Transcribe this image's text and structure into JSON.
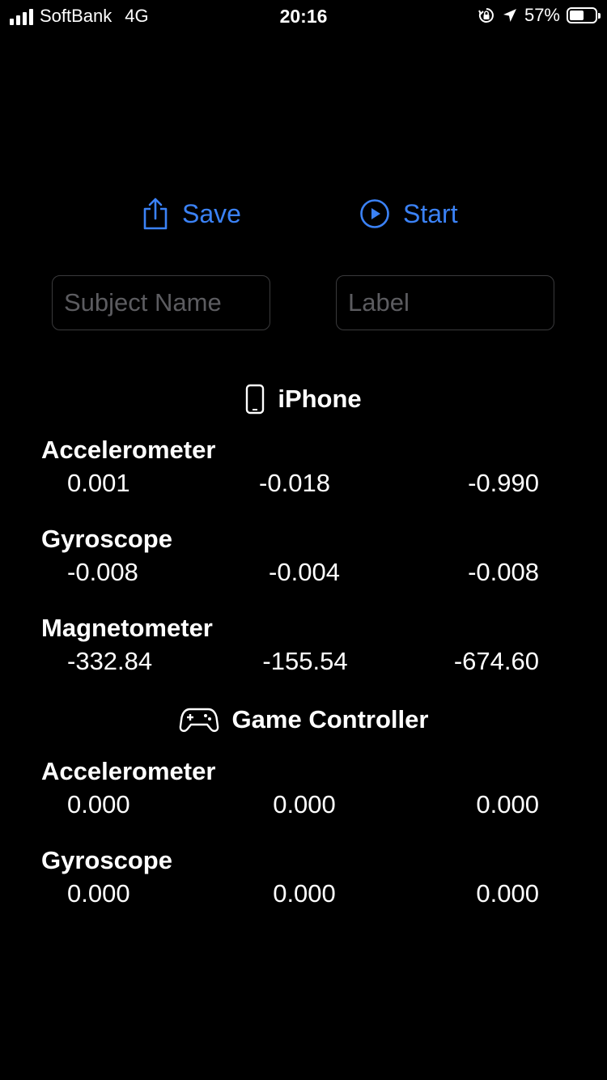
{
  "status_bar": {
    "carrier": "SoftBank",
    "network": "4G",
    "time": "20:16",
    "battery_percent": "57%",
    "battery_level": 0.57
  },
  "actions": {
    "save_label": "Save",
    "start_label": "Start"
  },
  "fields": {
    "subject_placeholder": "Subject Name",
    "label_placeholder": "Label"
  },
  "iphone": {
    "title": "iPhone",
    "sensors": [
      {
        "name": "Accelerometer",
        "values": [
          "0.001",
          "-0.018",
          "-0.990"
        ]
      },
      {
        "name": "Gyroscope",
        "values": [
          "-0.008",
          "-0.004",
          "-0.008"
        ]
      },
      {
        "name": "Magnetometer",
        "values": [
          "-332.84",
          "-155.54",
          "-674.60"
        ]
      }
    ]
  },
  "controller": {
    "title": "Game Controller",
    "sensors": [
      {
        "name": "Accelerometer",
        "values": [
          "0.000",
          "0.000",
          "0.000"
        ]
      },
      {
        "name": "Gyroscope",
        "values": [
          "0.000",
          "0.000",
          "0.000"
        ]
      }
    ]
  },
  "colors": {
    "accent": "#3b82f6",
    "background": "#000000",
    "text": "#ffffff"
  }
}
